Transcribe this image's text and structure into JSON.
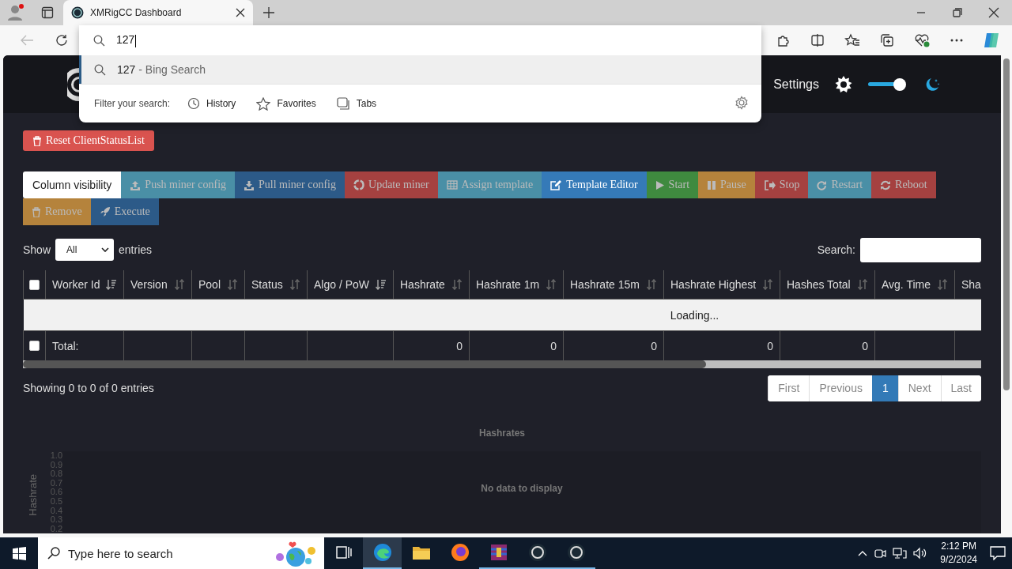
{
  "browser": {
    "tab": {
      "title": "XMRigCC Dashboard",
      "selected": true
    },
    "omnibox": {
      "value": "127",
      "suggestion": {
        "query": "127",
        "source": "- Bing Search",
        "selected": true
      },
      "filter_label": "Filter your search:",
      "filters": [
        "History",
        "Favorites",
        "Tabs"
      ]
    }
  },
  "navbar": {
    "settings": "Settings",
    "dark_mode": {
      "on": true
    }
  },
  "reset_button": "Reset ClientStatusList",
  "column_visibility": "Column visibility",
  "actions": [
    {
      "label": "Push miner config",
      "kind": "info",
      "disabled": true
    },
    {
      "label": "Pull miner config",
      "kind": "primary-dark",
      "disabled": true
    },
    {
      "label": "Update miner",
      "kind": "danger",
      "disabled": true
    },
    {
      "label": "Assign template",
      "kind": "info",
      "disabled": true
    },
    {
      "label": "Template Editor",
      "kind": "primary",
      "disabled": false
    },
    {
      "label": "Start",
      "kind": "success",
      "disabled": true
    },
    {
      "label": "Pause",
      "kind": "warning",
      "disabled": true
    },
    {
      "label": "Stop",
      "kind": "danger",
      "disabled": true
    },
    {
      "label": "Restart",
      "kind": "info",
      "disabled": true
    },
    {
      "label": "Reboot",
      "kind": "danger",
      "disabled": true
    },
    {
      "label": "Remove",
      "kind": "warning",
      "disabled": true
    },
    {
      "label": "Execute",
      "kind": "primary-dark",
      "disabled": true
    }
  ],
  "length": {
    "label_before": "Show",
    "value": "All",
    "label_after": "entries"
  },
  "search": {
    "label": "Search:"
  },
  "table": {
    "columns": [
      {
        "label": "Worker Id",
        "sorted": true
      },
      {
        "label": "Version",
        "sorted": false
      },
      {
        "label": "Pool",
        "sorted": false
      },
      {
        "label": "Status",
        "sorted": false
      },
      {
        "label": "Algo / PoW",
        "sorted": true
      },
      {
        "label": "Hashrate",
        "sorted": false
      },
      {
        "label": "Hashrate 1m",
        "sorted": false
      },
      {
        "label": "Hashrate 15m",
        "sorted": false
      },
      {
        "label": "Hashrate Highest",
        "sorted": false
      },
      {
        "label": "Hashes Total",
        "sorted": false
      },
      {
        "label": "Avg. Time",
        "sorted": false
      },
      {
        "label": "Sha"
      }
    ],
    "select_all": {
      "checked": false
    },
    "loading_message": "Loading...",
    "total_row": {
      "checked": false,
      "label": "Total:",
      "values": [
        "0",
        "0",
        "0",
        "0",
        "0"
      ]
    }
  },
  "info": "Showing 0 to 0 of 0 entries",
  "pagination": [
    {
      "label": "First",
      "selected": false,
      "disabled": true
    },
    {
      "label": "Previous",
      "selected": false,
      "disabled": true
    },
    {
      "label": "1",
      "selected": true,
      "disabled": false
    },
    {
      "label": "Next",
      "selected": false,
      "disabled": true
    },
    {
      "label": "Last",
      "selected": false,
      "disabled": true
    }
  ],
  "chart": {
    "title": "Hashrates",
    "ylabel": "Hashrate",
    "yticks": [
      "1.0",
      "0.9",
      "0.8",
      "0.7",
      "0.6",
      "0.5",
      "0.4",
      "0.3",
      "0.2"
    ],
    "message": "No data to display"
  },
  "taskbar": {
    "search_placeholder": "Type here to search",
    "apps": [
      {
        "selected": false,
        "running": false
      },
      {
        "selected": true,
        "running": true
      },
      {
        "selected": false,
        "running": false
      },
      {
        "selected": false,
        "running": false
      },
      {
        "selected": false,
        "running": true
      },
      {
        "selected": false,
        "running": true
      },
      {
        "selected": false,
        "running": true
      }
    ],
    "time": "2:12 PM",
    "date": "9/2/2024"
  }
}
